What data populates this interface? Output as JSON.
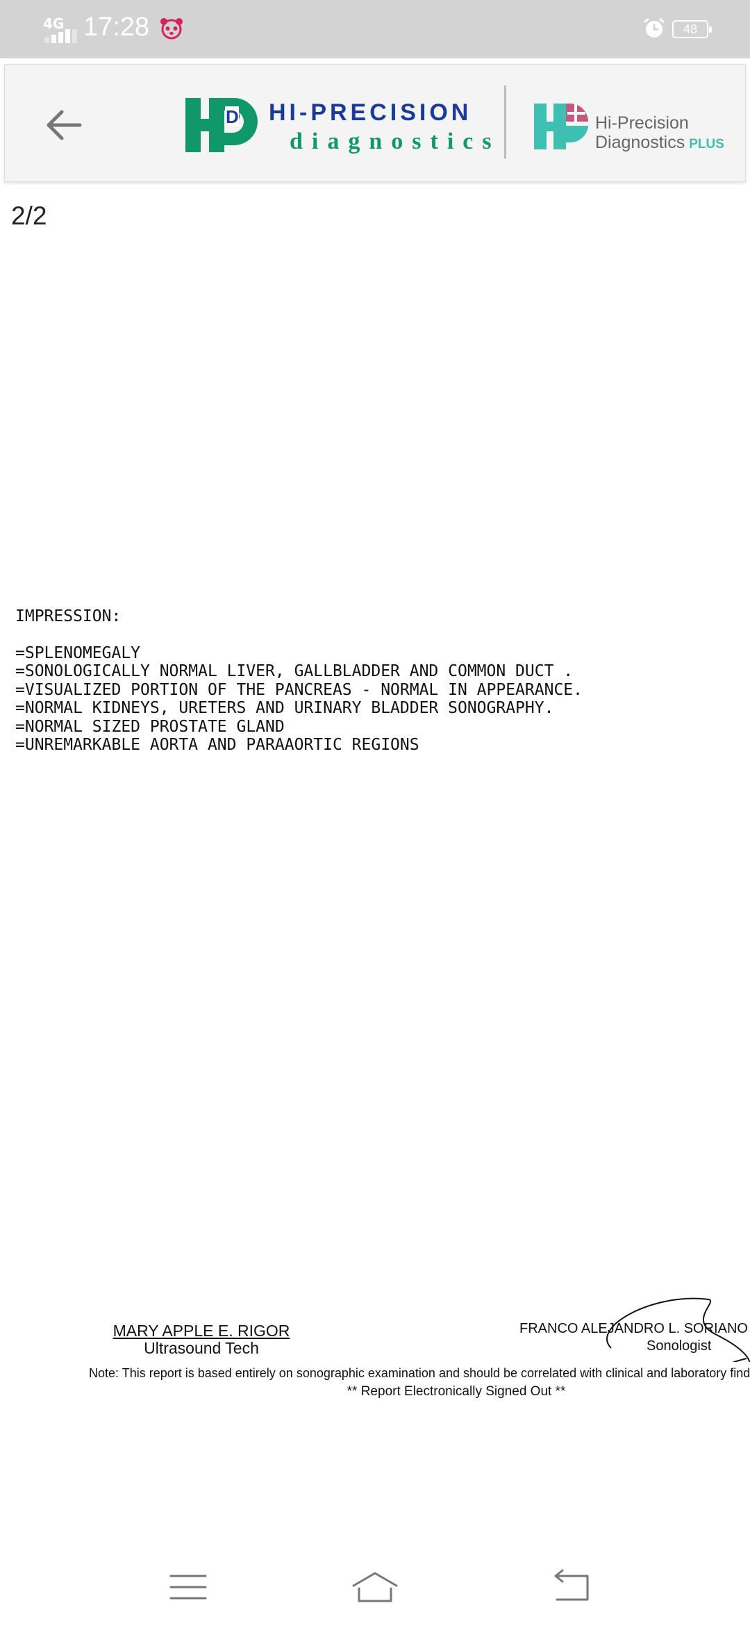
{
  "status_bar": {
    "network": "4G",
    "time": "17:28",
    "battery": "48",
    "icons": [
      "signal-icon",
      "panda-app-icon",
      "alarm-icon",
      "battery-icon"
    ]
  },
  "header": {
    "back_icon": "arrow-left-icon",
    "brand_name": "HI-PRECISION",
    "brand_sub": "diagnostics",
    "plus_line1": "Hi-Precision",
    "plus_line2": "Diagnostics",
    "plus_word": "PLUS",
    "colors": {
      "green": "#10976a",
      "blue": "#1a3a9c",
      "teal": "#3dbfb2",
      "pink": "#c8577e"
    }
  },
  "document": {
    "page_indicator": "2/2",
    "impression": {
      "heading": "IMPRESSION:",
      "lines": [
        "=SPLENOMEGALY",
        "=SONOLOGICALLY NORMAL LIVER, GALLBLADDER AND COMMON DUCT .",
        "=VISUALIZED PORTION OF THE PANCREAS - NORMAL IN APPEARANCE.",
        "=NORMAL KIDNEYS, URETERS AND URINARY BLADDER SONOGRAPHY.",
        "=NORMAL SIZED PROSTATE GLAND",
        "=UNREMARKABLE AORTA AND PARAAORTIC REGIONS"
      ]
    },
    "signatories": {
      "left_name": "MARY APPLE E. RIGOR",
      "left_role": "Ultrasound Tech",
      "right_name": "FRANCO ALEJANDRO L. SORIANO",
      "right_role": "Sonologist"
    },
    "note": "Note: This report is based entirely on sonographic examination and should be correlated with clinical and laboratory findings.",
    "signed_out": "** Report Electronically Signed Out **"
  },
  "nav_bar": {
    "icons": [
      "menu-icon",
      "home-icon",
      "back-nav-icon"
    ]
  }
}
